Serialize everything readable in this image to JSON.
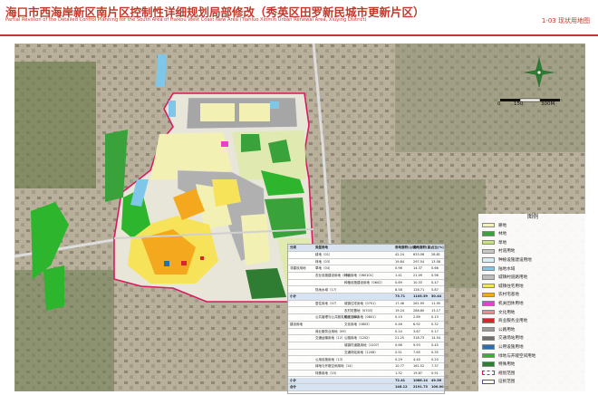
{
  "header": {
    "title_cn": "海口市西海岸新区南片区控制性详细规划局部修改（秀英区田罗新民城市更新片区）",
    "title_en": "Partial Revision of the Detailed Control Planning for the South Area of Haikou West Coast New Area (Tianluo Xinmin Urban Renewal Area, Xiuying District)",
    "sheet": "1-03  现状用地图"
  },
  "scale": {
    "labels": [
      "0",
      "150",
      "300M"
    ]
  },
  "legend": {
    "title": "图例",
    "items": [
      {
        "label": "耕地",
        "color": "#f3f0b4"
      },
      {
        "label": "林地",
        "color": "#3aa23a"
      },
      {
        "label": "草地",
        "color": "#c9e08a"
      },
      {
        "label": "村道用地",
        "color": "#c8c8c8"
      },
      {
        "label": "种植设施建设用地",
        "color": "#d9edf7"
      },
      {
        "label": "陆地水域",
        "color": "#7fc7e8"
      },
      {
        "label": "城镇村道路用地",
        "color": "#bdbdbd"
      },
      {
        "label": "城镇住宅用地",
        "color": "#f6e35a"
      },
      {
        "label": "农村宅基地",
        "color": "#f3a81e"
      },
      {
        "label": "机关团体用地",
        "color": "#e83dd1"
      },
      {
        "label": "文化用地",
        "color": "#f08a8a"
      },
      {
        "label": "商业服务业用地",
        "color": "#d7262b"
      },
      {
        "label": "公路用地",
        "color": "#9a9a9a"
      },
      {
        "label": "交通场站用地",
        "color": "#6f6f6f"
      },
      {
        "label": "公用设施用地",
        "color": "#2e6ea8"
      },
      {
        "label": "绿地与开敞空间用地",
        "color": "#2db52d"
      },
      {
        "label": "特殊用地",
        "color": "#2e7d32"
      },
      {
        "label": "规划范围",
        "color": "#d81b60"
      },
      {
        "label": "征拆范围",
        "color": "#ffffff"
      }
    ]
  },
  "land_table": {
    "headers": [
      "分类",
      "类型用地",
      "",
      "用地面积(公顷)",
      "用地面积(亩)",
      "占比(%)"
    ],
    "rows": [
      [
        "",
        "耕地（01）",
        "",
        "42.24",
        "633.56",
        "28.81"
      ],
      [
        "",
        "林地（03）",
        "",
        "19.84",
        "297.54",
        "13.58"
      ],
      [
        "非建设用地",
        "草地（04）",
        "",
        "0.96",
        "14.37",
        "0.66"
      ],
      [
        "",
        "农业设施建设用地（06）",
        "村道用地（060101）",
        "1.41",
        "21.09",
        "0.96"
      ],
      [
        "",
        "",
        "种植设施建设用地（0602）",
        "0.69",
        "10.33",
        "0.47"
      ],
      [
        "",
        "陆地水域（17）",
        "",
        "8.58",
        "128.71",
        "5.87"
      ],
      [
        "小计",
        "",
        "",
        "73.71",
        "1105.59",
        "50.44"
      ],
      [
        "",
        "居住用地（07）",
        "城镇住宅用地（0701）",
        "17.46",
        "261.95",
        "11.95"
      ],
      [
        "",
        "",
        "农村宅基地（0703）",
        "19.24",
        "288.60",
        "13.17"
      ],
      [
        "",
        "公共管理与公共服务用地（08）",
        "机关团体用地（0801）",
        "0.19",
        "2.89",
        "0.13"
      ],
      [
        "建设用地",
        "",
        "文化用地（0803）",
        "0.46",
        "6.92",
        "0.32"
      ],
      [
        "",
        "商业服务业用地（09）",
        "",
        "0.24",
        "3.67",
        "0.17"
      ],
      [
        "",
        "交通运输用地（12）",
        "公路用地（1202）",
        "21.25",
        "318.73",
        "14.54"
      ],
      [
        "",
        "",
        "城镇村道路用地（1207）",
        "0.66",
        "9.93",
        "0.45"
      ],
      [
        "",
        "",
        "交通场站用地（1208）",
        "0.51",
        "7.65",
        "0.35"
      ],
      [
        "",
        "公用设施用地（13）",
        "",
        "0.29",
        "4.40",
        "0.20"
      ],
      [
        "",
        "绿地与开敞空间用地（14）",
        "",
        "10.77",
        "161.52",
        "7.37"
      ],
      [
        "",
        "特殊用地（15）",
        "",
        "1.32",
        "19.87",
        "0.91"
      ],
      [
        "小计",
        "",
        "",
        "72.41",
        "1086.14",
        "49.56"
      ],
      [
        "合计",
        "",
        "",
        "146.12",
        "2191.73",
        "100.00"
      ]
    ]
  }
}
